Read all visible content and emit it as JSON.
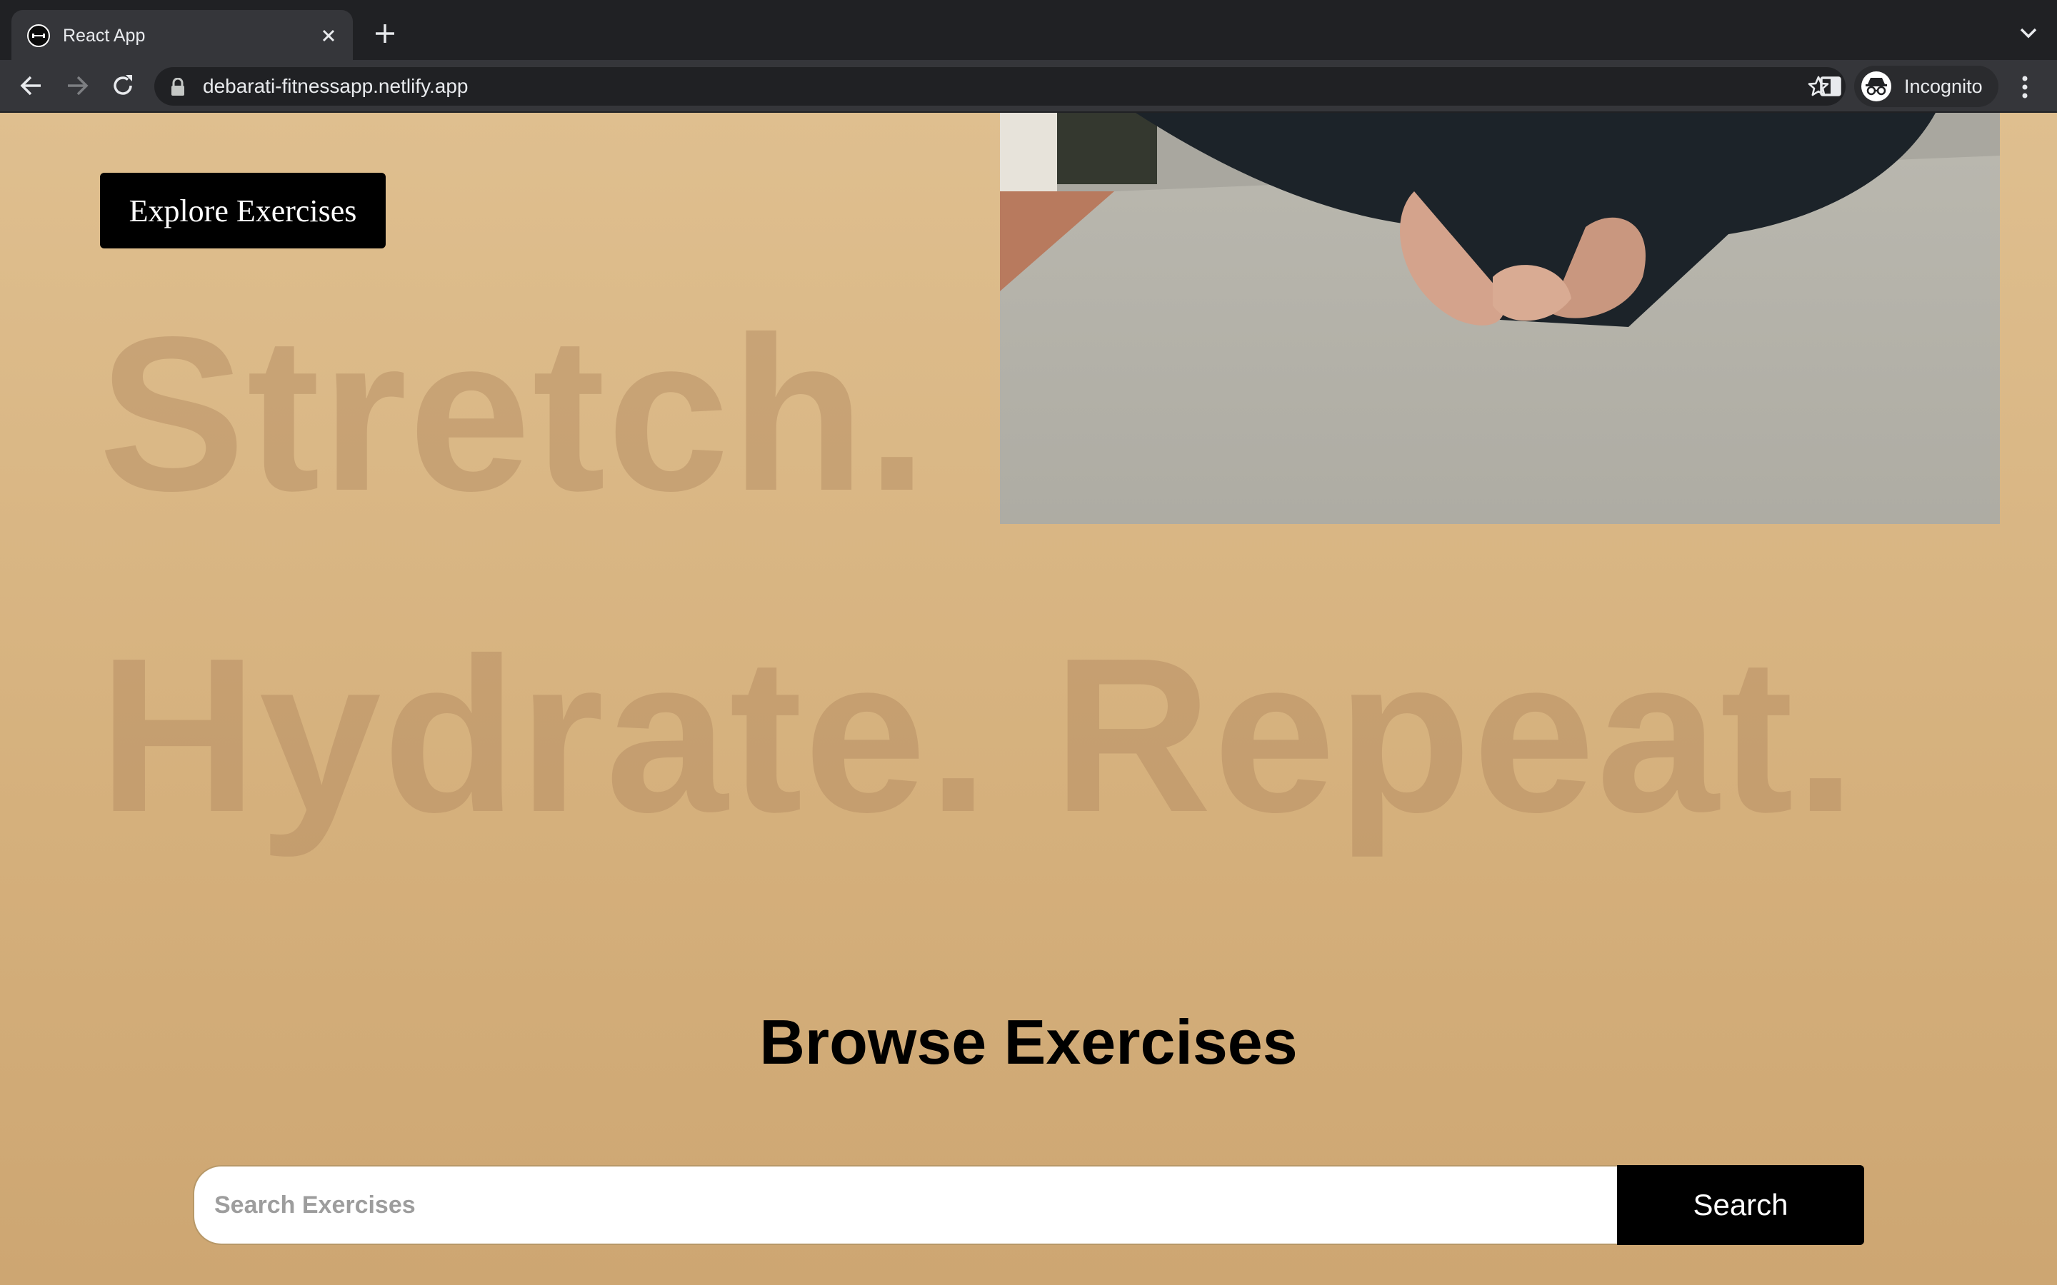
{
  "browser": {
    "tab": {
      "title": "React App",
      "favicon": "dumbbell-icon"
    },
    "address_bar": {
      "url": "debarati-fitnessapp.netlify.app"
    },
    "profile": {
      "label": "Incognito"
    }
  },
  "hero": {
    "explore_button_label": "Explore Exercises",
    "headline_line1": "Stretch.",
    "headline_line2": "Hydrate. Repeat.",
    "image": "person-seated-cross-legged-on-cushion"
  },
  "browse": {
    "title": "Browse Exercises",
    "search": {
      "placeholder": "Search Exercises",
      "value": "",
      "button_label": "Search"
    }
  },
  "colors": {
    "page_background_top": "#dfbf8f",
    "page_background_bottom": "#cda672",
    "headline_text": "#b28960",
    "button_background": "#000000",
    "button_text": "#ffffff",
    "browser_chrome": "#35363a",
    "tabstrip": "#202124"
  }
}
